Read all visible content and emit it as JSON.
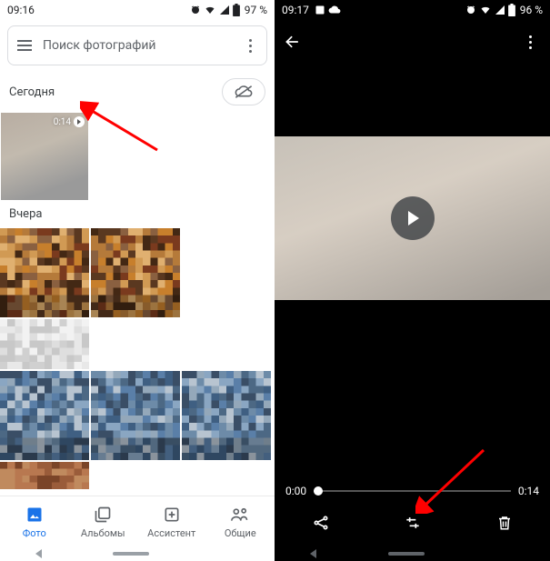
{
  "left": {
    "status": {
      "time": "09:16",
      "battery_text": "97 %"
    },
    "search": {
      "placeholder": "Поиск фотографий"
    },
    "sections": {
      "today": {
        "label": "Сегодня",
        "video_duration": "0:14"
      },
      "yesterday": {
        "label": "Вчера"
      }
    },
    "bottom_nav": {
      "photos": "Фото",
      "albums": "Альбомы",
      "assistant": "Ассистент",
      "sharing": "Общие"
    }
  },
  "right": {
    "status": {
      "time": "09:17",
      "battery_text": "96 %"
    },
    "scrubber": {
      "start": "0:00",
      "end": "0:14"
    }
  }
}
